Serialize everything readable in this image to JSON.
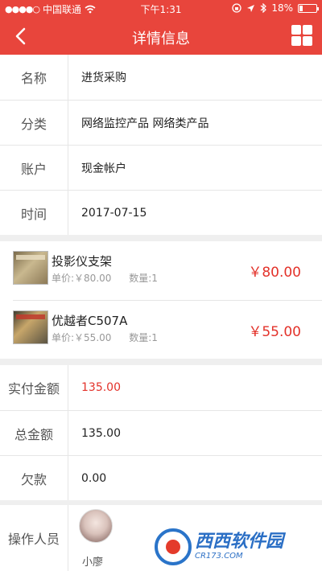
{
  "statusbar": {
    "carrier": "中国联通",
    "time": "下午1:31",
    "battery_pct": "18%",
    "battery_level": 0.18,
    "signal_icon": "signal-dots-icon",
    "wifi_icon": "wifi-icon",
    "lock_icon": "rotation-lock-icon",
    "location_icon": "location-arrow-icon",
    "bluetooth_icon": "bluetooth-icon"
  },
  "navbar": {
    "back_icon": "back-chevron-icon",
    "title": "详情信息",
    "menu_icon": "grid-menu-icon",
    "bg_color": "#e8453c"
  },
  "info": [
    {
      "label": "名称",
      "value": "进货采购"
    },
    {
      "label": "分类",
      "value": "网络监控产品 网络类产品"
    },
    {
      "label": "账户",
      "value": "现金帐户"
    },
    {
      "label": "时间",
      "value": "2017-07-15"
    }
  ],
  "products": [
    {
      "name": "投影仪支架",
      "unit_price": "单价:￥80.00",
      "quantity": "数量:1",
      "price": "￥80.00"
    },
    {
      "name": "优越者C507A",
      "unit_price": "单价:￥55.00",
      "quantity": "数量:1",
      "price": "￥55.00"
    }
  ],
  "totals": [
    {
      "label": "实付金额",
      "value": "135.00",
      "accent": true
    },
    {
      "label": "总金额",
      "value": "135.00",
      "accent": false
    },
    {
      "label": "欠款",
      "value": "0.00",
      "accent": false
    }
  ],
  "operator": {
    "label": "操作人员",
    "name": "小廖"
  },
  "watermark": {
    "main": "西西软件园",
    "sub": "CR173.COM"
  },
  "colors": {
    "accent": "#e8453c",
    "price_red": "#e3322a"
  }
}
